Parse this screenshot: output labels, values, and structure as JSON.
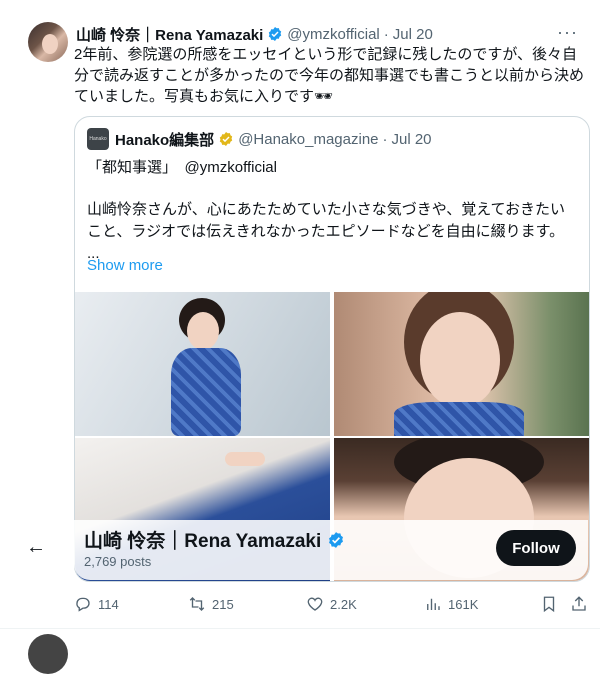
{
  "tweet": {
    "author_name": "山崎 怜奈｜Rena Yamazaki",
    "handle": "@ymzkofficial",
    "separator": "·",
    "date": "Jul 20",
    "more": "···",
    "text": "2年前、参院選の所感をエッセイという形で記録に残したのですが、後々自分で読み返すことが多かったので今年の都知事選でも書こうと以前から決めていました。写真もお気に入りです🕶"
  },
  "quote": {
    "avatar_text": "Hanako",
    "author_name": "Hanako編集部",
    "handle": "@Hanako_magazine",
    "separator": "·",
    "date": "Jul 20",
    "line1": "「都知事選」　@ymzkofficial",
    "line2": "山崎怜奈さんが、心にあたためていた小さな気づきや、覚えておきたいこと、ラジオでは伝えきれなかったエピソードなどを自由に綴ります。",
    "line3": "...",
    "show_more": "Show more"
  },
  "profile_card": {
    "back_icon": "←",
    "name": "山崎 怜奈｜Rena Yamazaki",
    "posts": "2,769 posts",
    "follow_label": "Follow"
  },
  "actions": {
    "replies": "114",
    "reposts": "215",
    "likes": "2.2K",
    "views": "161K"
  },
  "colors": {
    "accent": "#1d9bf0",
    "verified": "#1d9bf0",
    "verified_gold": "#e2b719",
    "text": "#0f1419",
    "muted": "#536471"
  }
}
